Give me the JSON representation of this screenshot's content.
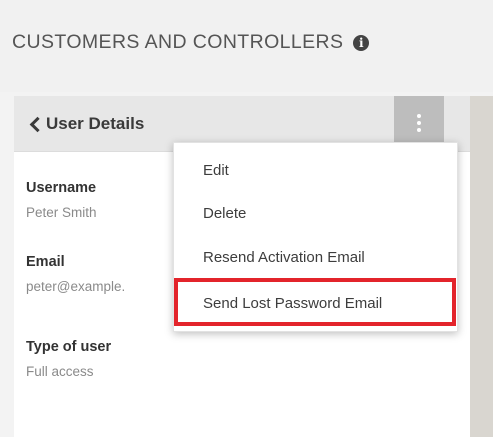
{
  "page": {
    "title": "CUSTOMERS AND CONTROLLERS",
    "info_icon": "info-icon"
  },
  "card": {
    "back_label": "User Details",
    "menu_icon": "kebab-icon",
    "fields": [
      {
        "label": "Username",
        "value": "Peter Smith"
      },
      {
        "label": "Email",
        "value": "peter@example."
      },
      {
        "label": "Type of user",
        "value": "Full access"
      }
    ]
  },
  "dropdown": {
    "items": [
      {
        "label": "Edit"
      },
      {
        "label": "Delete"
      },
      {
        "label": "Resend Activation Email"
      },
      {
        "label": "Send Lost Password Email",
        "highlighted": true
      }
    ]
  },
  "colors": {
    "highlight": "#e3242b",
    "header_bg": "#e7e7e7",
    "menu_button_bg": "#bdbdbd"
  }
}
